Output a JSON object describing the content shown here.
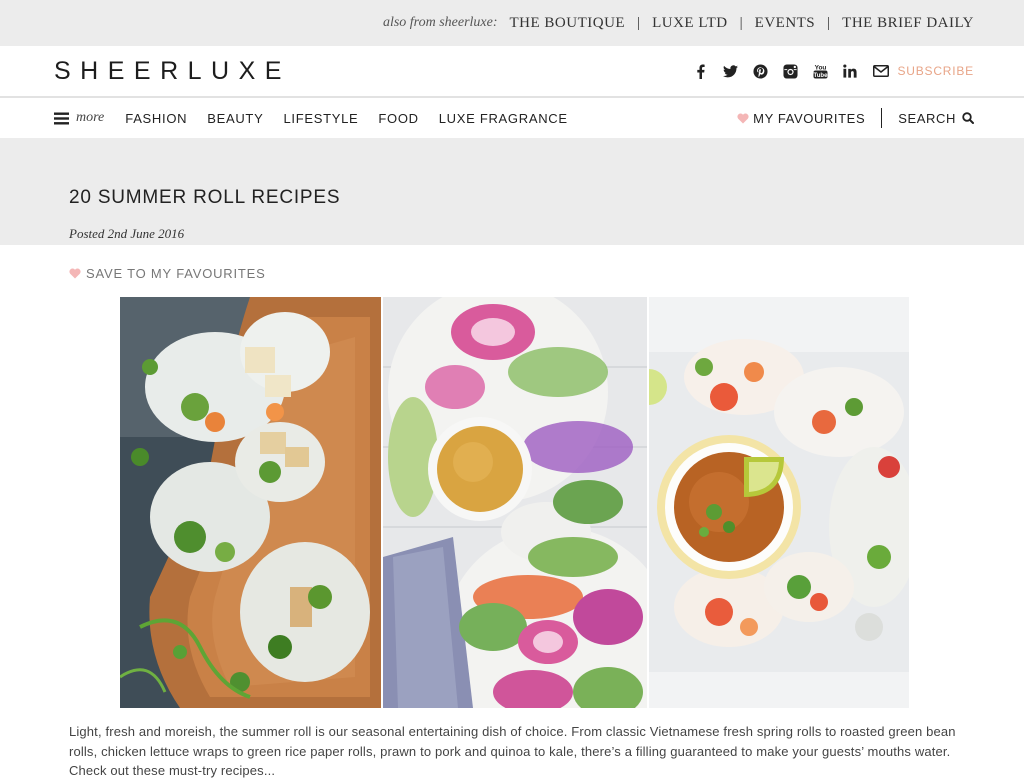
{
  "topbar": {
    "also_from": "also from sheerluxe:",
    "links": [
      "THE BOUTIQUE",
      "LUXE LTD",
      "EVENTS",
      "THE BRIEF DAILY"
    ],
    "separator": "|"
  },
  "header": {
    "logo": "SHEERLUXE",
    "social_icons": [
      "facebook-icon",
      "twitter-icon",
      "pinterest-icon",
      "instagram-icon",
      "youtube-icon",
      "linkedin-icon"
    ],
    "subscribe_label": "SUBSCRIBE",
    "subscribe_color": "#e8a588"
  },
  "nav": {
    "more_label": "more",
    "items": [
      "FASHION",
      "BEAUTY",
      "LIFESTYLE",
      "FOOD",
      "LUXE FRAGRANCE"
    ],
    "favourites_label": "MY FAVOURITES",
    "search_label": "SEARCH"
  },
  "article": {
    "title": "20 SUMMER ROLL RECIPES",
    "posted": "Posted 2nd June 2016",
    "save_label": "SAVE TO MY FAVOURITES",
    "heart_color": "#f4b6b6",
    "images": [
      "summer rolls with tofu on a wooden board",
      "beetroot rainbow rolls with peanut dip",
      "prawn summer rolls with satay dip and lime"
    ],
    "intro": "Light, fresh and moreish, the summer roll is our seasonal entertaining dish of choice. From classic Vietnamese fresh spring rolls to roasted green bean rolls, chicken lettuce wraps to green rice paper rolls, prawn to pork and quinoa to kale, there’s a filling guaranteed to make your guests’ mouths water. Check out these must-try recipes..."
  }
}
